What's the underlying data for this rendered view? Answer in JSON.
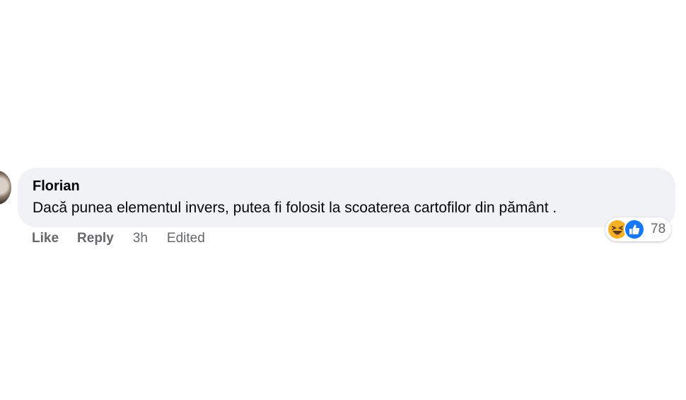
{
  "comment": {
    "author": "Florian",
    "text": "Dacă punea elementul invers, putea fi folosit la scoaterea cartofilor din pământ ."
  },
  "actions": {
    "like_label": "Like",
    "reply_label": "Reply",
    "timestamp": "3h",
    "edited_label": "Edited"
  },
  "reactions": {
    "icons": [
      "haha-icon",
      "like-icon"
    ],
    "count": "78"
  },
  "colors": {
    "bubble_bg": "#f0f2f5",
    "text": "#050505",
    "secondary_text": "#65676b",
    "like_blue": "#1877f2",
    "haha_yellow": "#f7b125"
  }
}
